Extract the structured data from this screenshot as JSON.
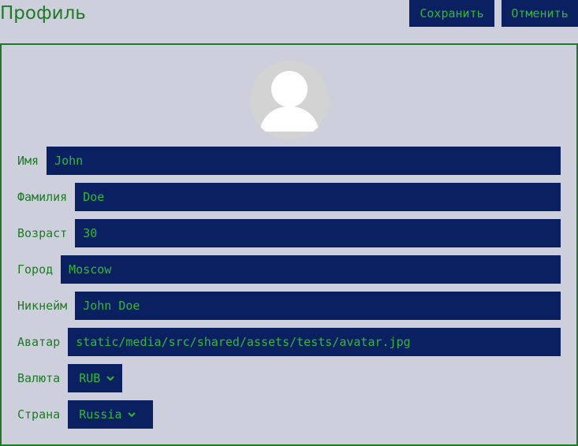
{
  "header": {
    "title": "Профиль",
    "save_label": "Сохранить",
    "cancel_label": "Отменить"
  },
  "avatar": {
    "icon": "user-silhouette-icon"
  },
  "form": {
    "first_name": {
      "label": "Имя",
      "value": "John"
    },
    "last_name": {
      "label": "Фамилия",
      "value": "Doe"
    },
    "age": {
      "label": "Возраст",
      "value": "30"
    },
    "city": {
      "label": "Город",
      "value": "Moscow"
    },
    "username": {
      "label": "Никнейм",
      "value": "John Doe"
    },
    "avatar_url": {
      "label": "Аватар",
      "value": "static/media/src/shared/assets/tests/avatar.jpg"
    },
    "currency": {
      "label": "Валюта",
      "value": "RUB"
    },
    "country": {
      "label": "Страна",
      "value": "Russia"
    }
  },
  "colors": {
    "background": "#cdd0dc",
    "accent_green": "#1e7a25",
    "field_text_green": "#31b83b",
    "field_bg_navy": "#0b2060",
    "avatar_bg": "#d0d0d0"
  }
}
